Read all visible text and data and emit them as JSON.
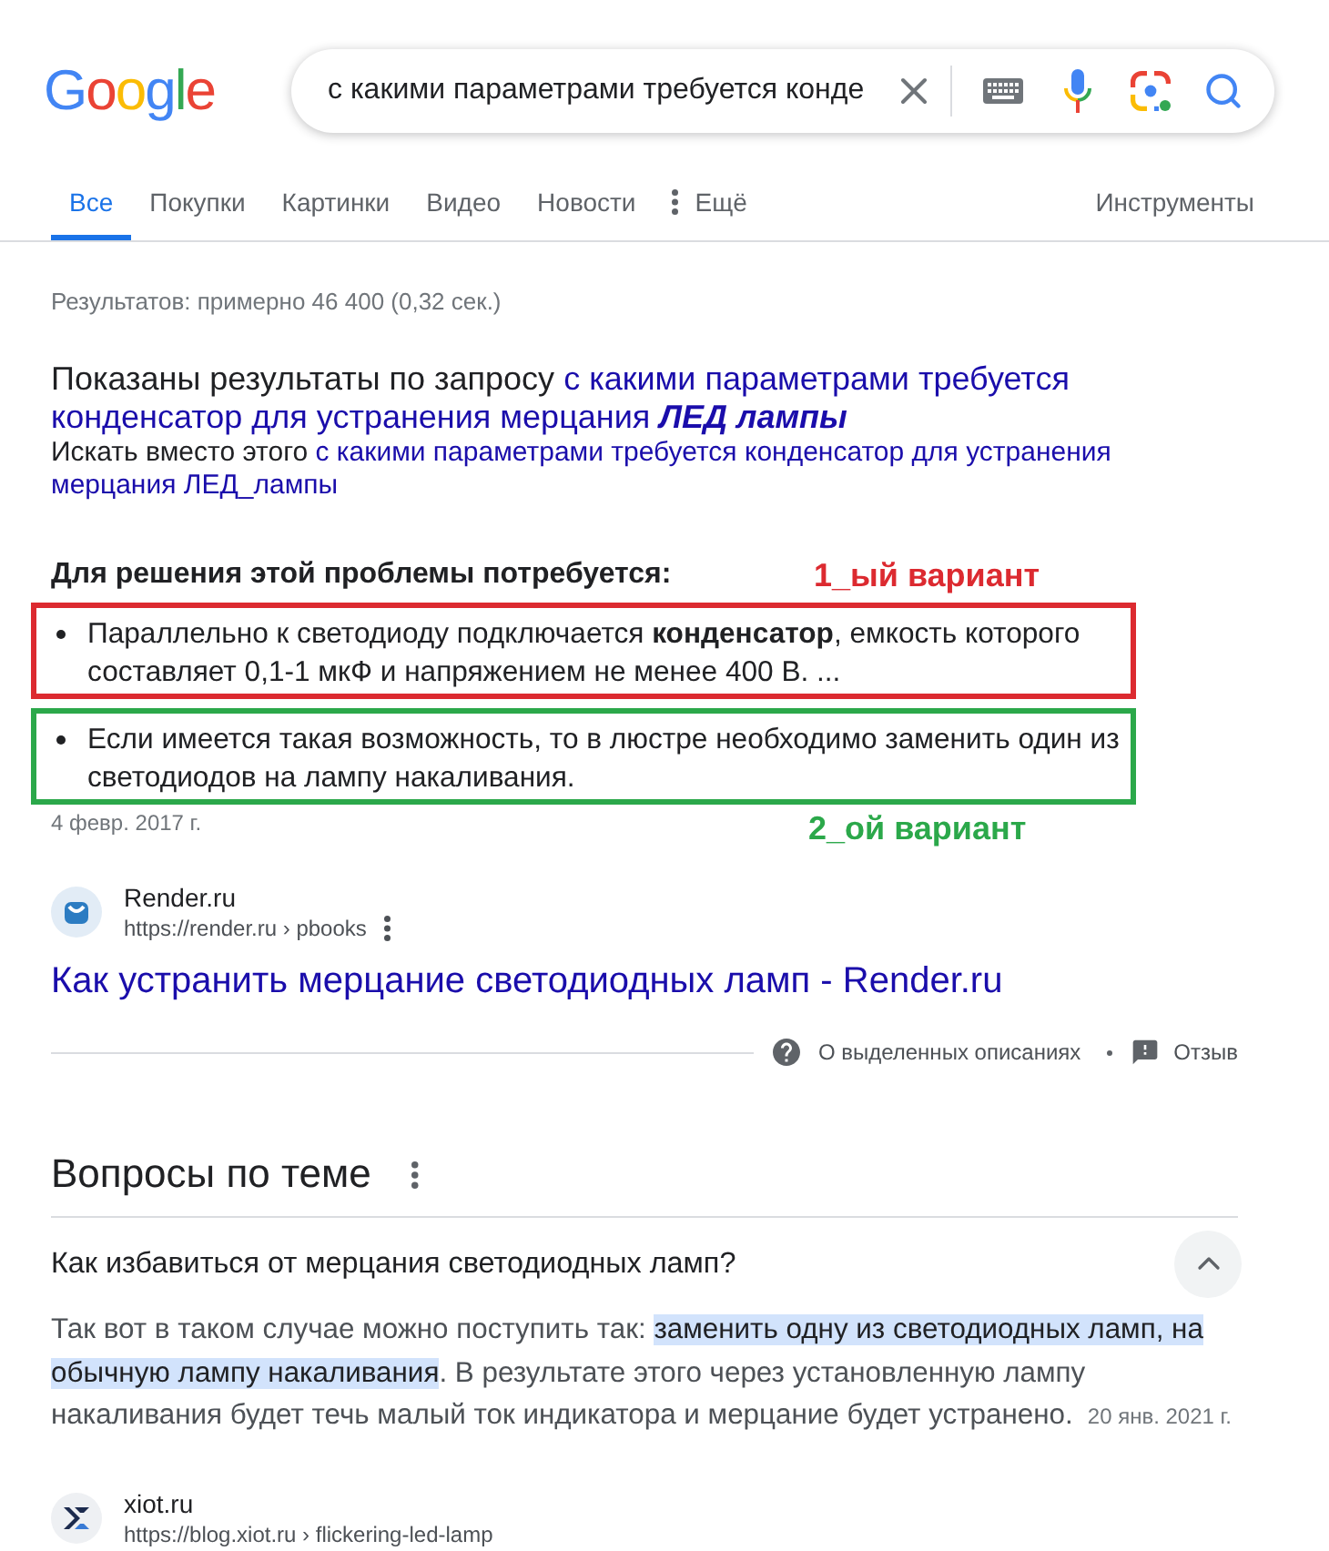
{
  "header": {
    "logo": "Google",
    "search": {
      "value": "с какими параметрами требуется конде"
    }
  },
  "tabs": [
    {
      "label": "Все",
      "selected": true
    },
    {
      "label": "Покупки",
      "selected": false
    },
    {
      "label": "Картинки",
      "selected": false
    },
    {
      "label": "Видео",
      "selected": false
    },
    {
      "label": "Новости",
      "selected": false
    },
    {
      "label": "Ещё",
      "selected": false,
      "kind": "more"
    }
  ],
  "tools": "Инструменты",
  "result_stats": "Результатов: примерно 46 400 (0,32 сек.)",
  "spelling": {
    "showing_label": "Показаны результаты по запросу",
    "corrected_query": "с какими параметрами требуется конденсатор для устранения мерцания",
    "corrected_term": "ЛЕД лампы",
    "search_instead_label": "Искать вместо этого",
    "original_query": "с какими параметрами требуется конденсатор для устранения мерцания ЛЕД_лампы"
  },
  "featured_snippet": {
    "heading": "Для решения этой проблемы потребуется:",
    "items": [
      {
        "text": "Параллельно к светодиоду подключается **конденсатор**, емкость которого составляет 0,1-1 мкФ и напряжением не менее 400 В. ...",
        "annotation": {
          "kind": "above",
          "label": "1_ый вариант",
          "color": "#dc2a30"
        }
      },
      {
        "text": "Если имеется такая возможность, то в люстре необходимо заменить один из светодиодов на лампу накаливания.",
        "annotation": {
          "kind": "below",
          "label": "2_ой вариант",
          "color": "#2ba84a"
        }
      }
    ],
    "date": "4 февр. 2017 г.",
    "source": {
      "site": "Render.ru",
      "url": "https://render.ru › pbooks",
      "title": "Как устранить мерцание светодиодных ламп - Render.ru"
    }
  },
  "snippet_footer": {
    "about": "О выделенных описаниях",
    "feedback": "Отзыв"
  },
  "related_questions": {
    "title": "Вопросы по теме",
    "items": [
      {
        "question": "Как избавиться от мерцания светодиодных ламп?",
        "expanded": true,
        "answer": [
          {
            "text": "Так вот в таком случае можно поступить так: ",
            "highlighted": false
          },
          {
            "text": "заменить одну из светодиодных ламп, на обычную лампу накаливания",
            "highlighted": true
          },
          {
            "text": ". В результате этого через установленную лампу накаливания будет течь малый ток индикатора и мерцание будет устранено.",
            "highlighted": false
          }
        ],
        "date": "20 янв. 2021 г.",
        "source": {
          "site": "xiot.ru",
          "url": "https://blog.xiot.ru › flickering-led-lamp"
        }
      }
    ]
  }
}
